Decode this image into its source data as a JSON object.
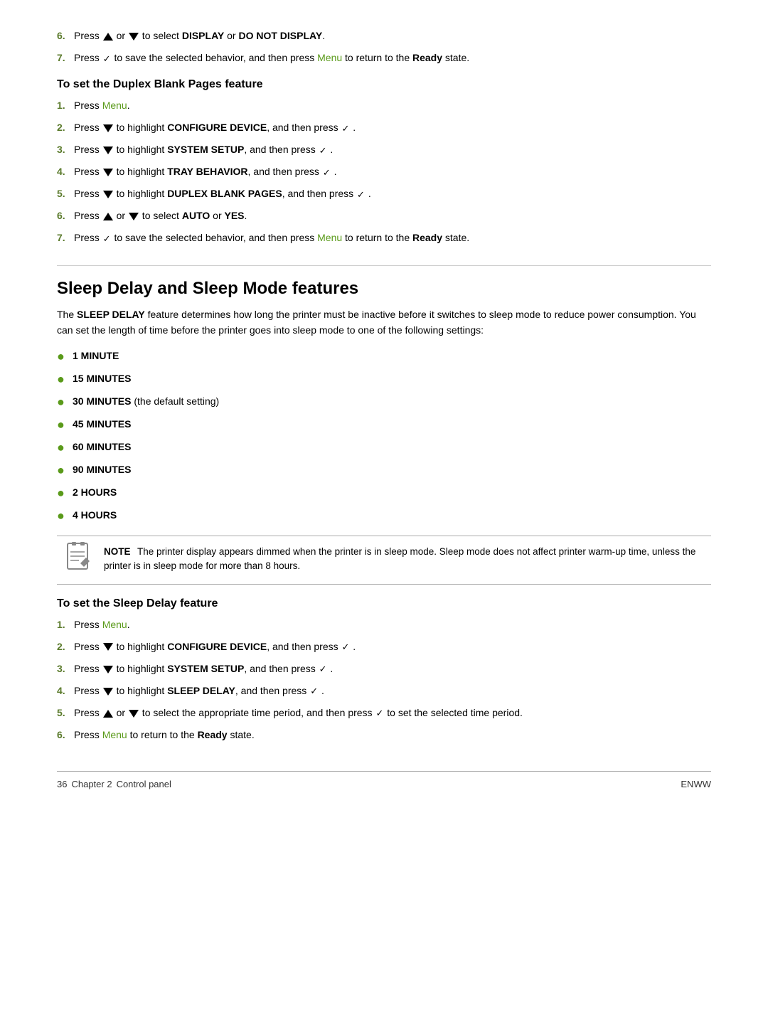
{
  "page": {
    "footer": {
      "page_number": "36",
      "chapter_label": "Chapter 2",
      "chapter_name": "Control panel",
      "enww": "ENWW"
    }
  },
  "section_duplex": {
    "heading": "To set the Duplex Blank Pages feature",
    "steps": [
      {
        "num": "6.",
        "text_before": "Press",
        "triangle_up": true,
        "text_mid": "or",
        "triangle_down": true,
        "text_after": "to select",
        "bold": "DISPLAY",
        "text_end": "or",
        "bold2": "DO NOT DISPLAY",
        "text_final": "."
      },
      {
        "num": "7.",
        "text_before": "Press",
        "check": true,
        "text_mid": "to save the selected behavior, and then press",
        "menu_link": "Menu",
        "text_after": "to return to the",
        "bold": "Ready",
        "text_final": "state."
      }
    ],
    "subsection_steps": [
      {
        "num": "1.",
        "text_before": "Press",
        "menu_link": "Menu",
        "text_after": "."
      },
      {
        "num": "2.",
        "text_before": "Press",
        "triangle_down": true,
        "text_mid": "to highlight",
        "bold": "CONFIGURE DEVICE",
        "text_after": ", and then press",
        "check": true,
        ".": "."
      },
      {
        "num": "3.",
        "text_before": "Press",
        "triangle_down": true,
        "text_mid": "to highlight",
        "bold": "SYSTEM SETUP",
        "text_after": ", and then press",
        "check": true,
        ".": "."
      },
      {
        "num": "4.",
        "text_before": "Press",
        "triangle_down": true,
        "text_mid": "to highlight",
        "bold": "TRAY BEHAVIOR",
        "text_after": ", and then press",
        "check": true,
        ".": "."
      },
      {
        "num": "5.",
        "text_before": "Press",
        "triangle_down": true,
        "text_mid": "to highlight",
        "bold": "DUPLEX BLANK PAGES",
        "text_after": ", and then press",
        "check": true,
        ".": "."
      },
      {
        "num": "6.",
        "text_before": "Press",
        "triangle_up": true,
        "text_mid": "or",
        "triangle_down2": true,
        "text_after": "to select",
        "bold": "AUTO",
        "text_end": "or",
        "bold2": "YES",
        ".": "."
      },
      {
        "num": "7.",
        "text_before": "Press",
        "check": true,
        "text_mid": "to save the selected behavior, and then press",
        "menu_link": "Menu",
        "text_after": "to return to the",
        "bold": "Ready",
        "text_final": "state."
      }
    ]
  },
  "section_sleep": {
    "main_heading": "Sleep Delay and Sleep Mode features",
    "body_text": "The SLEEP DELAY feature determines how long the printer must be inactive before it switches to sleep mode to reduce power consumption. You can set the length of time before the printer goes into sleep mode to one of the following settings:",
    "bullet_items": [
      {
        "text": "1 MINUTE"
      },
      {
        "text": "15 MINUTES"
      },
      {
        "text": "30 MINUTES (the default setting)"
      },
      {
        "text": "45 MINUTES"
      },
      {
        "text": "60 MINUTES"
      },
      {
        "text": "90 MINUTES"
      },
      {
        "text": "2 HOURS"
      },
      {
        "text": "4 HOURS"
      }
    ],
    "note_label": "NOTE",
    "note_text": "The printer display appears dimmed when the printer is in sleep mode. Sleep mode does not affect printer warm-up time, unless the printer is in sleep mode for more than 8 hours.",
    "subsection_heading": "To set the Sleep Delay feature",
    "subsection_steps": [
      {
        "num": "1.",
        "text_before": "Press",
        "menu_link": "Menu",
        "text_after": "."
      },
      {
        "num": "2.",
        "text_before": "Press",
        "triangle_down": true,
        "text_mid": "to highlight",
        "bold": "CONFIGURE DEVICE",
        "text_after": ", and then press",
        "check": true,
        ".": "."
      },
      {
        "num": "3.",
        "text_before": "Press",
        "triangle_down": true,
        "text_mid": "to highlight",
        "bold": "SYSTEM SETUP",
        "text_after": ", and then press",
        "check": true,
        ".": "."
      },
      {
        "num": "4.",
        "text_before": "Press",
        "triangle_down": true,
        "text_mid": "to highlight",
        "bold": "SLEEP DELAY",
        "text_after": ", and then press",
        "check": true,
        ".": "."
      },
      {
        "num": "5.",
        "text_before": "Press",
        "triangle_up": true,
        "text_mid": "or",
        "triangle_down2": true,
        "text_after": "to select the appropriate time period, and then press",
        "check": true,
        "text_final": "to set the selected time period."
      },
      {
        "num": "6.",
        "text_before": "Press",
        "menu_link": "Menu",
        "text_mid": "to return to the",
        "bold": "Ready",
        "text_after": "state."
      }
    ]
  }
}
